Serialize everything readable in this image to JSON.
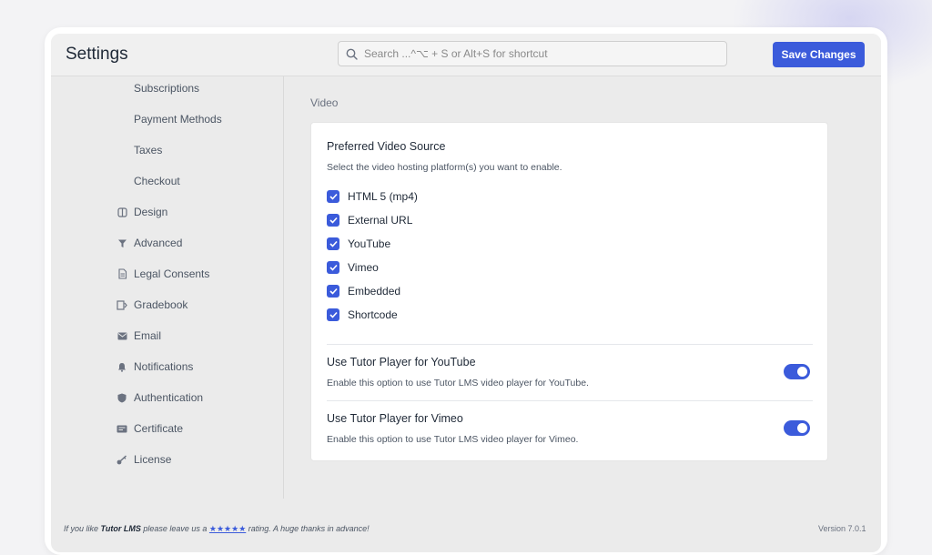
{
  "header": {
    "title": "Settings",
    "search_placeholder": "Search ...^⌥ + S or Alt+S for shortcut",
    "save_label": "Save Changes"
  },
  "sidebar": {
    "items": [
      {
        "label": "Subscriptions",
        "icon": ""
      },
      {
        "label": "Payment Methods",
        "icon": ""
      },
      {
        "label": "Taxes",
        "icon": ""
      },
      {
        "label": "Checkout",
        "icon": ""
      },
      {
        "label": "Design",
        "icon": "design-icon"
      },
      {
        "label": "Advanced",
        "icon": "advanced-icon"
      },
      {
        "label": "Legal Consents",
        "icon": "document-icon"
      },
      {
        "label": "Gradebook",
        "icon": "gradebook-icon"
      },
      {
        "label": "Email",
        "icon": "envelope-icon"
      },
      {
        "label": "Notifications",
        "icon": "bell-icon"
      },
      {
        "label": "Authentication",
        "icon": "shield-icon"
      },
      {
        "label": "Certificate",
        "icon": "certificate-icon"
      },
      {
        "label": "License",
        "icon": "key-icon"
      }
    ]
  },
  "main": {
    "section_label": "Video",
    "video_source": {
      "title": "Preferred Video Source",
      "description": "Select the video hosting platform(s) you want to enable.",
      "options": [
        {
          "label": "HTML 5 (mp4)",
          "checked": true
        },
        {
          "label": "External URL",
          "checked": true
        },
        {
          "label": "YouTube",
          "checked": true
        },
        {
          "label": "Vimeo",
          "checked": true
        },
        {
          "label": "Embedded",
          "checked": true
        },
        {
          "label": "Shortcode",
          "checked": true
        }
      ]
    },
    "toggles": [
      {
        "title": "Use Tutor Player for YouTube",
        "description": "Enable this option to use Tutor LMS video player for YouTube.",
        "on": true
      },
      {
        "title": "Use Tutor Player for Vimeo",
        "description": "Enable this option to use Tutor LMS video player for Vimeo.",
        "on": true
      }
    ]
  },
  "footer": {
    "prefix": "If you like ",
    "brand": "Tutor LMS",
    "middle": " please leave us a ",
    "stars": "★★★★★",
    "suffix": " rating. A huge thanks in advance!",
    "version": "Version 7.0.1"
  },
  "colors": {
    "accent": "#3b5bdb",
    "background": "#ebebeb",
    "card": "#ffffff"
  }
}
